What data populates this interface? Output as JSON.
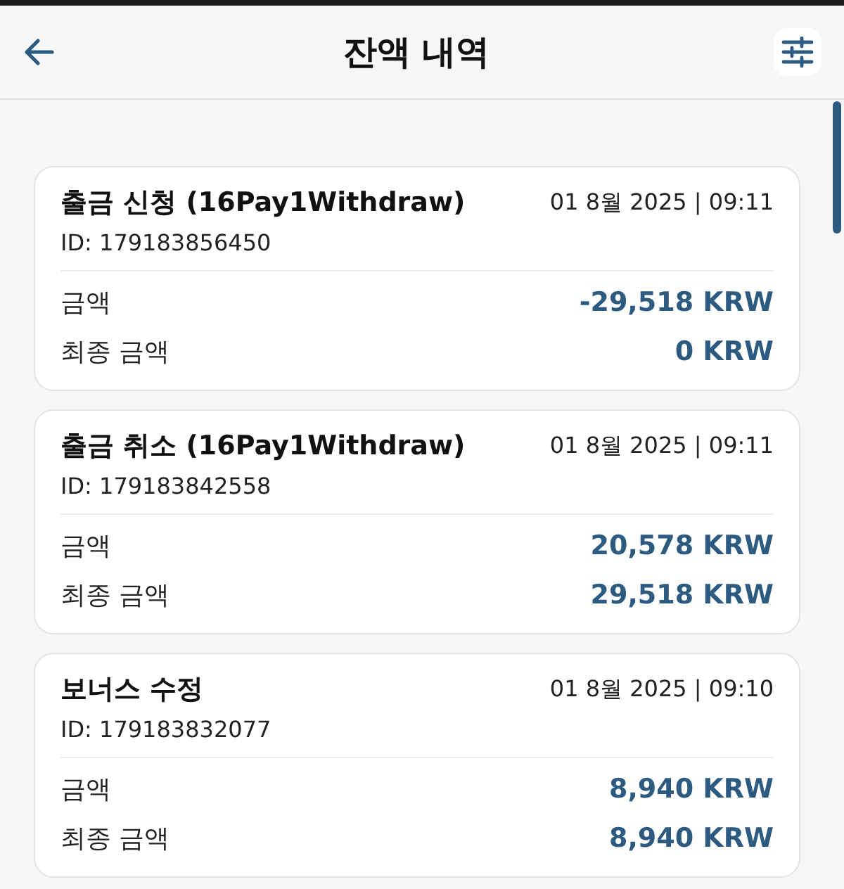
{
  "header": {
    "title": "잔액 내역"
  },
  "transactions": [
    {
      "title": "출금 신청 (16Pay1Withdraw)",
      "datetime": "01 8월 2025 | 09:11",
      "id": "ID: 179183856450",
      "rows": [
        {
          "label": "금액",
          "value": "-29,518 KRW"
        },
        {
          "label": "최종 금액",
          "value": "0 KRW"
        }
      ]
    },
    {
      "title": "출금 취소 (16Pay1Withdraw)",
      "datetime": "01 8월 2025 | 09:11",
      "id": "ID: 179183842558",
      "rows": [
        {
          "label": "금액",
          "value": "20,578 KRW"
        },
        {
          "label": "최종 금액",
          "value": "29,518 KRW"
        }
      ]
    },
    {
      "title": "보너스 수정",
      "datetime": "01 8월 2025 | 09:10",
      "id": "ID: 179183832077",
      "rows": [
        {
          "label": "금액",
          "value": "8,940 KRW"
        },
        {
          "label": "최종 금액",
          "value": "8,940 KRW"
        }
      ]
    }
  ]
}
